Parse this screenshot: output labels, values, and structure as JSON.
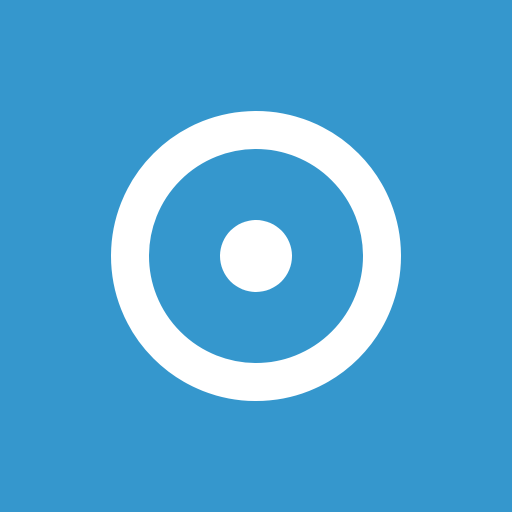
{
  "icon": {
    "name": "record-icon",
    "background_color": "#3597cd",
    "foreground_color": "#ffffff"
  }
}
